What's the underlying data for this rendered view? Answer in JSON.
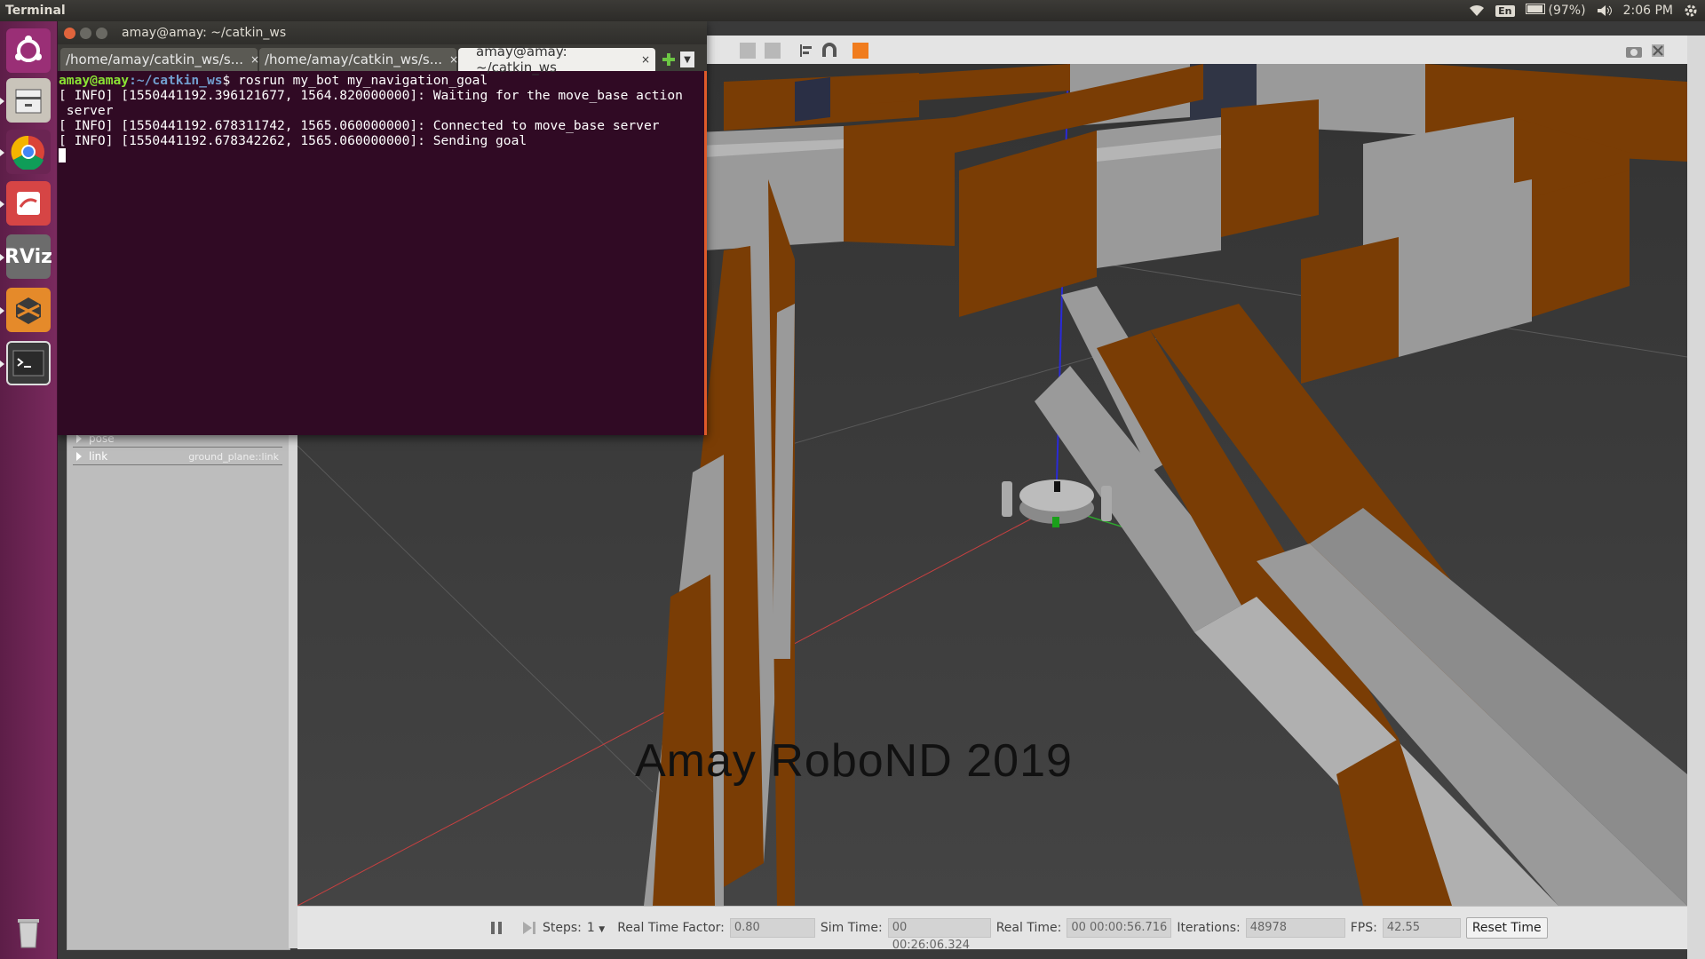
{
  "top_panel": {
    "app_title": "Terminal",
    "language": "En",
    "battery": "(97%)",
    "clock": "2:06 PM"
  },
  "launcher": {
    "items": [
      "ubuntu-home",
      "files",
      "chrome",
      "text-editor",
      "RViz",
      "gazebo",
      "terminal",
      "trash"
    ],
    "rviz_label": "RViz"
  },
  "terminal": {
    "window_title": "amay@amay: ~/catkin_ws",
    "tabs": [
      {
        "label": "/home/amay/catkin_ws/s...",
        "close": "×"
      },
      {
        "label": "/home/amay/catkin_ws/s...",
        "close": "×"
      },
      {
        "label": "amay@amay: ~/catkin_ws",
        "close": "×"
      }
    ],
    "prompt_user": "amay@amay",
    "prompt_path": ":~/catkin_ws",
    "prompt_cmd": "$ rosrun my_bot my_navigation_goal",
    "lines": [
      "[ INFO] [1550441192.396121677, 1564.820000000]: Waiting for the move_base action",
      " server",
      "[ INFO] [1550441192.678311742, 1565.060000000]: Connected to move_base server",
      "[ INFO] [1550441192.678342262, 1565.060000000]: Sending goal"
    ]
  },
  "gazebo": {
    "properties": [
      {
        "name": "pose",
        "value": ""
      },
      {
        "name": "link",
        "value": "ground_plane::link"
      }
    ],
    "watermark": "Amay RoboND 2019",
    "bottom_bar": {
      "steps_label": "Steps:",
      "steps_value": "1",
      "rtf_label": "Real Time Factor:",
      "rtf_value": "0.80",
      "sim_time_label": "Sim Time:",
      "sim_time_value": "00 00:26:06.324",
      "real_time_label": "Real Time:",
      "real_time_value": "00 00:00:56.716",
      "iterations_label": "Iterations:",
      "iterations_value": "48978",
      "fps_label": "FPS:",
      "fps_value": "42.55",
      "reset_label": "Reset Time"
    }
  },
  "colors": {
    "terminal_bg": "#300a24",
    "wall_brown": "#7a3d05",
    "wall_gray": "#9a9a9a",
    "floor": "#3c3c3c"
  }
}
